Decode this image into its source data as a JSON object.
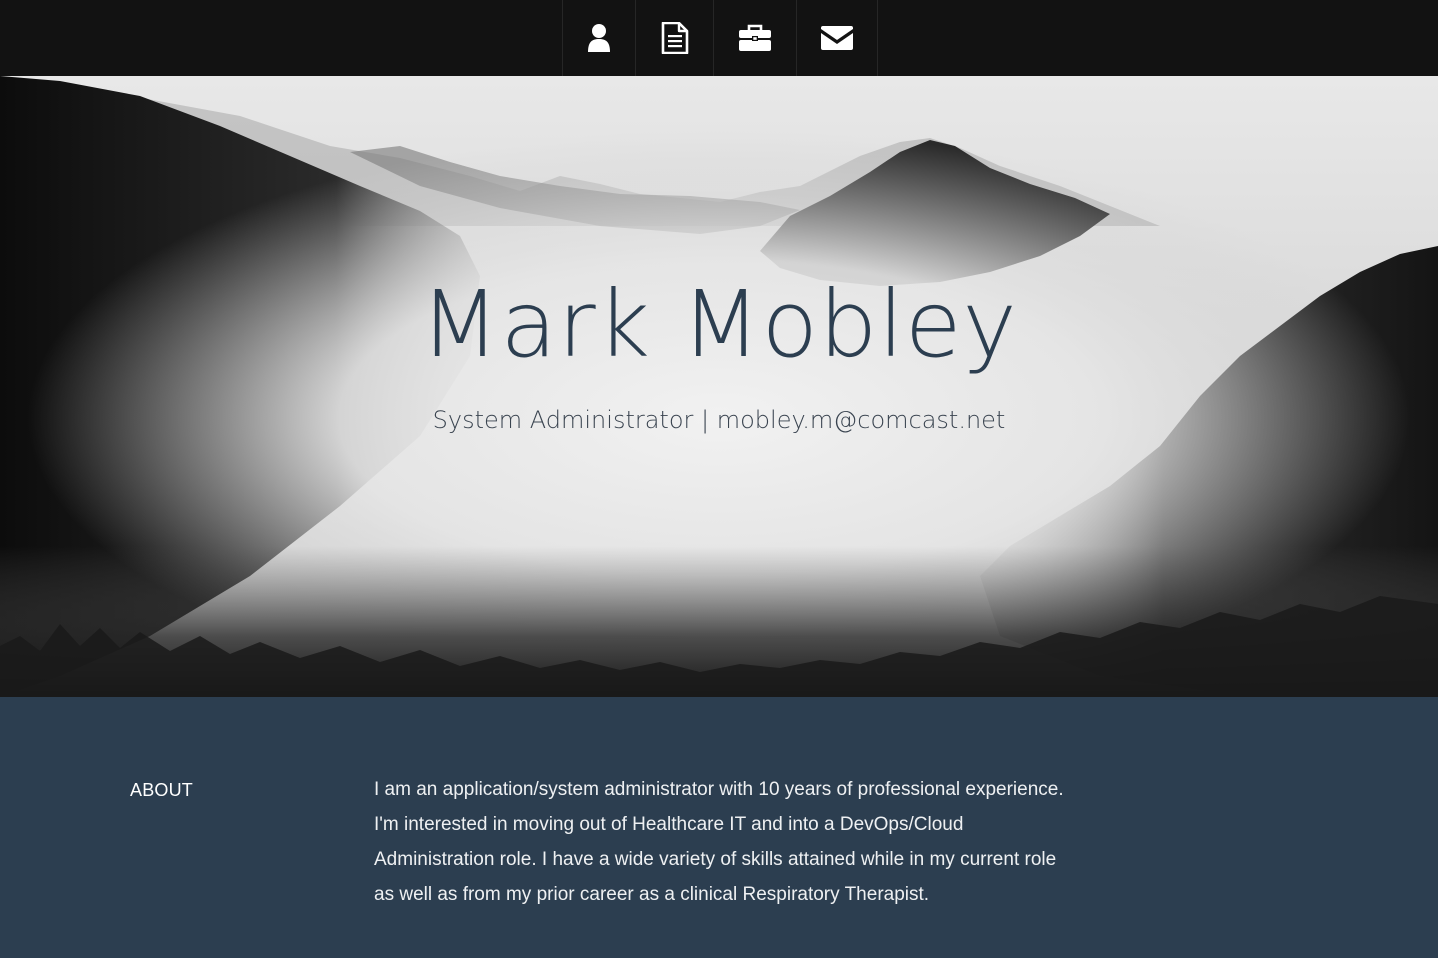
{
  "nav": {
    "items": [
      {
        "icon": "user-icon"
      },
      {
        "icon": "document-icon"
      },
      {
        "icon": "briefcase-icon"
      },
      {
        "icon": "envelope-icon"
      }
    ]
  },
  "hero": {
    "title": "Mark Mobley",
    "subtitle": "System Administrator | mobley.m@comcast.net"
  },
  "about": {
    "heading": "ABOUT",
    "text": "I am an application/system administrator with 10 years of professional experience. I'm interested in moving out of Healthcare IT and into a DevOps/Cloud Administration role. I have a wide variety of skills attained while in my current role as well as from my prior career as a clinical Respiratory Therapist."
  },
  "colors": {
    "nav_bg": "#121212",
    "accent": "#2c3e50",
    "text_light": "#ffffff"
  }
}
